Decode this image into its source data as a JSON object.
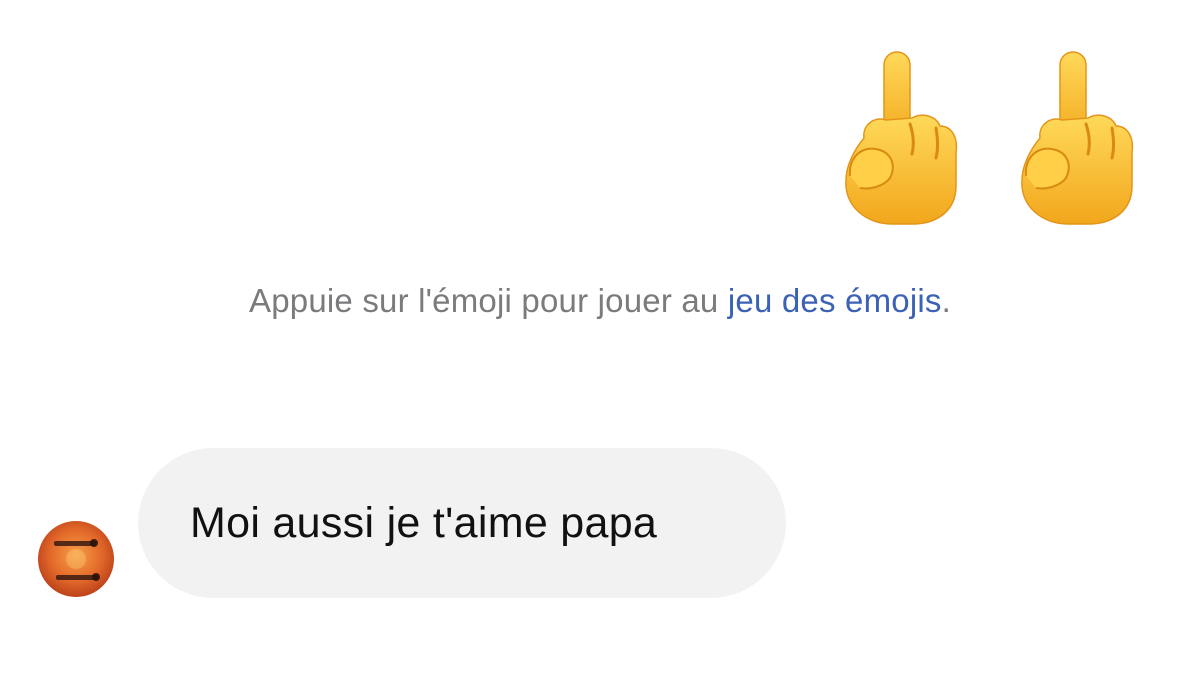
{
  "outgoing_message": {
    "emojis": [
      {
        "icon": "middle-finger-emoji-icon",
        "glyph": "🖕"
      },
      {
        "icon": "middle-finger-emoji-icon",
        "glyph": "🖕"
      }
    ]
  },
  "hint": {
    "text_before": "Appuie sur l'émoji pour jouer au ",
    "link_text": "jeu des émojis",
    "text_after": ".",
    "text_color": "#7b7b7e",
    "link_color": "#3b62b5"
  },
  "incoming_message": {
    "avatar_icon": "contact-avatar",
    "text": "Moi aussi je t'aime papa",
    "bubble_color": "#f2f2f3"
  }
}
